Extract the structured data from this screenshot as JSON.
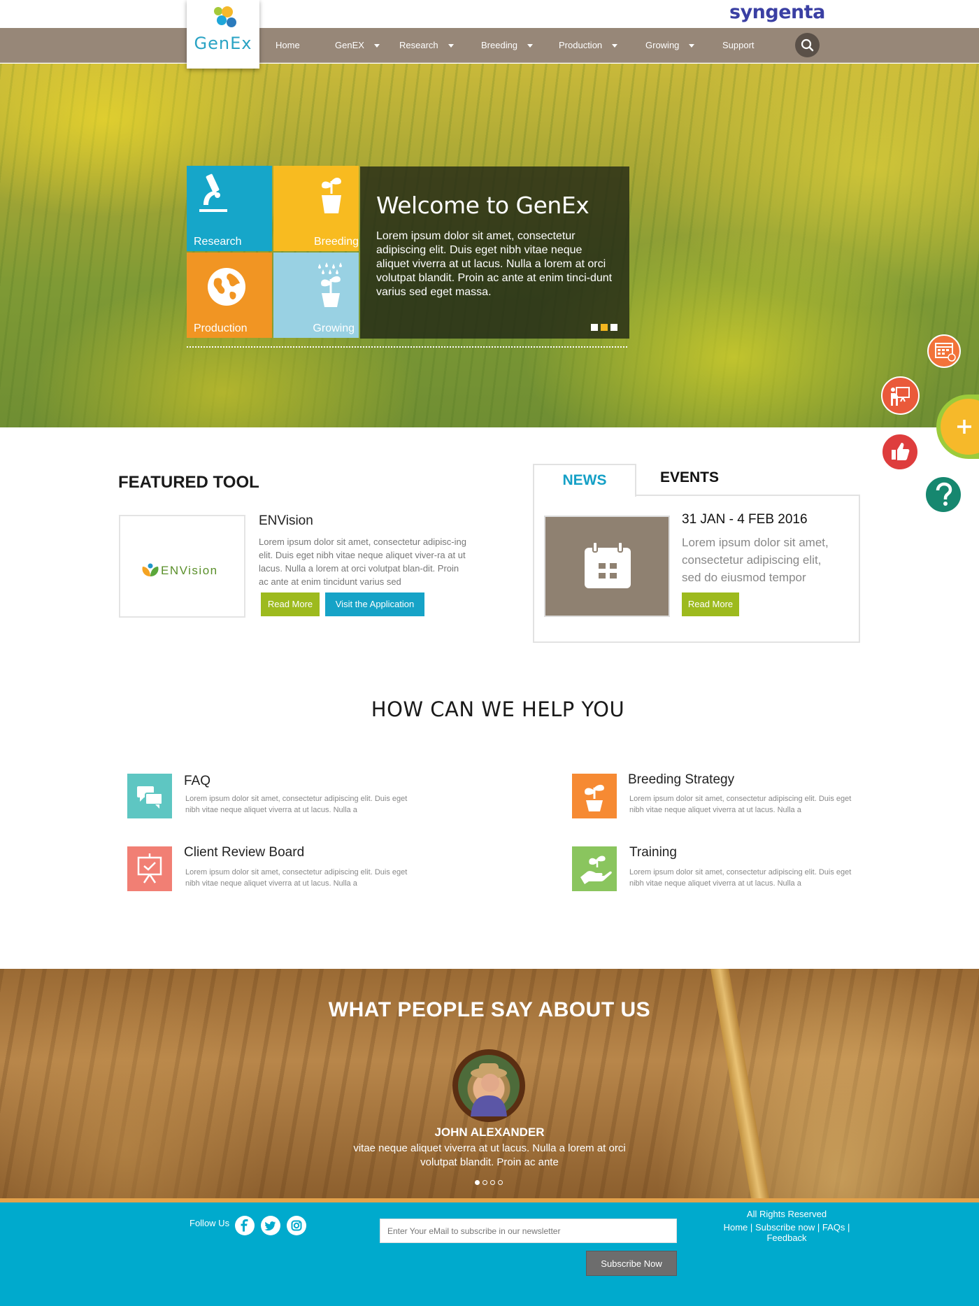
{
  "header": {
    "brand": "syngenta",
    "logo_text": "GenEx"
  },
  "nav": [
    {
      "label": "Home",
      "dropdown": false
    },
    {
      "label": "GenEX",
      "dropdown": true
    },
    {
      "label": "Research",
      "dropdown": true
    },
    {
      "label": "Breeding",
      "dropdown": true
    },
    {
      "label": "Production",
      "dropdown": true
    },
    {
      "label": "Growing",
      "dropdown": true
    },
    {
      "label": "Support",
      "dropdown": false
    }
  ],
  "hero": {
    "tiles": [
      {
        "label": "Research",
        "icon": "microscope-icon",
        "color": "#16a6c9"
      },
      {
        "label": "Breeding",
        "icon": "plant-pot-icon",
        "color": "#f8bb20"
      },
      {
        "label": "Production",
        "icon": "globe-icon",
        "color": "#f19523"
      },
      {
        "label": "Growing",
        "icon": "watering-plant-icon",
        "color": "#99d1e3"
      }
    ],
    "title": "Welcome to GenEx",
    "text": "Lorem ipsum dolor sit amet, consectetur adipiscing elit. Duis eget nibh vitae neque aliquet viverra at ut lacus. Nulla a lorem at orci volutpat blandit. Proin ac ante at enim tinci-dunt varius sed eget massa."
  },
  "featured": {
    "heading": "FEATURED TOOL",
    "tool_logo": "ENVision",
    "tool_title": "ENVision",
    "tool_desc": "Lorem ipsum dolor sit amet, consectetur adipisc-ing elit. Duis eget nibh vitae neque aliquet viver-ra at ut lacus. Nulla a lorem at orci volutpat blan-dit. Proin ac ante at enim tincidunt varius sed",
    "read_more": "Read More",
    "visit": "Visit the Application"
  },
  "news": {
    "tabs": [
      "NEWS",
      "EVENTS"
    ],
    "date": "31 JAN - 4 FEB  2016",
    "text": "Lorem ipsum dolor sit amet, consectetur adipiscing elit, sed do eiusmod tempor",
    "read_more": "Read More"
  },
  "help": {
    "title": "HOW CAN WE HELP YOU",
    "items": [
      {
        "title": "FAQ",
        "desc": "Lorem ipsum dolor sit amet, consectetur adipiscing elit. Duis eget nibh vitae neque aliquet viverra at ut lacus. Nulla a",
        "icon": "chat-bubbles-icon",
        "color": "#5ec6c2"
      },
      {
        "title": "Breeding Strategy",
        "desc": "Lorem ipsum dolor sit amet, consectetur adipiscing elit. Duis eget nibh vitae neque aliquet viverra at ut lacus. Nulla a",
        "icon": "plant-pot-icon",
        "color": "#f68a33"
      },
      {
        "title": "Client Review Board",
        "desc": "Lorem ipsum dolor sit amet, consectetur adipiscing elit. Duis eget nibh vitae neque aliquet viverra at ut lacus. Nulla a",
        "icon": "presentation-board-icon",
        "color": "#f17f74"
      },
      {
        "title": "Training",
        "desc": "Lorem ipsum dolor sit amet, consectetur adipiscing elit. Duis eget nibh vitae neque aliquet viverra at ut lacus. Nulla a",
        "icon": "hand-plant-icon",
        "color": "#8ac55e"
      }
    ]
  },
  "testimonials": {
    "title": "WHAT PEOPLE SAY ABOUT US",
    "name": "JOHN ALEXANDER",
    "quote": "vitae neque aliquet viverra at ut lacus. Nulla a lorem at orci volutpat blandit. Proin ac ante",
    "active_dot": 1,
    "dot_count": 4
  },
  "footer": {
    "follow": "Follow Us",
    "newsletter_placeholder": "Enter Your eMail to subscribe in our newsletter",
    "subscribe": "Subscribe Now",
    "rights": "All Rights Reserved",
    "links": [
      "Home",
      "Subscribe now",
      "FAQs",
      "Feedback"
    ]
  },
  "side_buttons": [
    {
      "icon": "calendar-icon",
      "color": "#f2733a"
    },
    {
      "icon": "presentation-icon",
      "color": "#ea5a3a"
    },
    {
      "icon": "thumbs-up-icon",
      "color": "#de3d3d"
    },
    {
      "icon": "question-icon",
      "color": "#16876f"
    },
    {
      "icon": "plus-icon",
      "color": "#f6b92a"
    }
  ]
}
